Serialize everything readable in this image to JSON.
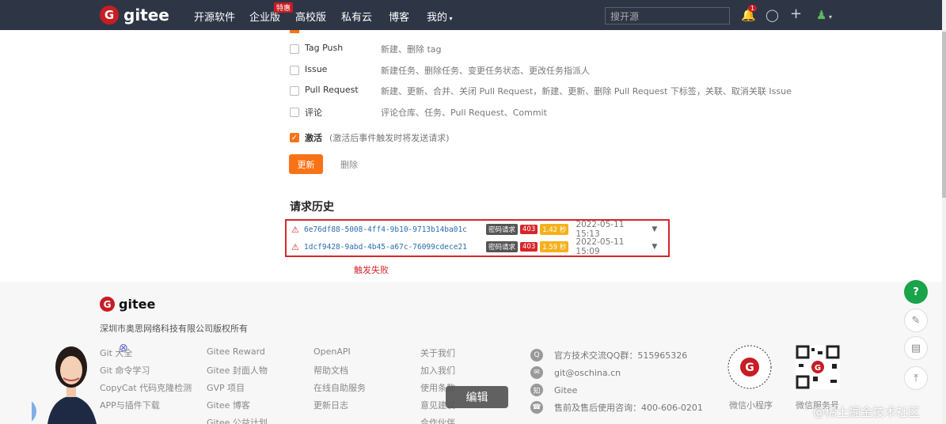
{
  "nav": {
    "logo": "gitee",
    "items": [
      "开源软件",
      "企业版",
      "高校版",
      "私有云",
      "博客",
      "我的"
    ],
    "hot_badge": "特惠",
    "search_placeholder": "搜开源",
    "notif_count": "1"
  },
  "events": [
    {
      "name": "Tag Push",
      "desc": "新建、删除 tag",
      "checked": false
    },
    {
      "name": "Issue",
      "desc": "新建任务、删除任务、变更任务状态、更改任务指派人",
      "checked": false
    },
    {
      "name": "Pull Request",
      "desc": "新建、更新、合并、关闭 Pull Request，新建、更新、删除 Pull Request 下标签，关联、取消关联 Issue",
      "checked": false
    },
    {
      "name": "评论",
      "desc": "评论仓库、任务、Pull Request、Commit",
      "checked": false
    }
  ],
  "activate": {
    "label": "激活",
    "hint": "(激活后事件触发时将发送请求)",
    "checked": true
  },
  "buttons": {
    "update": "更新",
    "delete": "删除"
  },
  "history": {
    "title": "请求历史",
    "rows": [
      {
        "id": "6e76df88-5008-4ff4-9b10-9713b14ba01c",
        "tag": "密码请求",
        "status": "403",
        "duration": "1.42 秒",
        "time": "2022-05-11 15:13"
      },
      {
        "id": "1dcf9428-9abd-4b45-a67c-76099cdece21",
        "tag": "密码请求",
        "status": "403",
        "duration": "1.59 秒",
        "time": "2022-05-11 15:09"
      }
    ],
    "note": "触发失败"
  },
  "footer": {
    "logo": "gitee",
    "company": "深圳市奥思网络科技有限公司版权所有",
    "col1": [
      "Git 大全",
      "Git 命令学习",
      "CopyCat 代码克隆检测",
      "APP与插件下载"
    ],
    "col2": [
      "Gitee Reward",
      "Gitee 封面人物",
      "GVP 项目",
      "Gitee 博客",
      "Gitee 公益计划"
    ],
    "col3": [
      "OpenAPI",
      "帮助文档",
      "在线自助服务",
      "更新日志"
    ],
    "col4": [
      "关于我们",
      "加入我们",
      "使用条款",
      "意见建议",
      "合作伙伴"
    ],
    "contacts": [
      "官方技术交流QQ群：515965326",
      "git@oschina.cn",
      "Gitee",
      "售前及售后使用咨询：400-606-0201"
    ],
    "qr_labels": [
      "微信小程序",
      "微信服务号"
    ]
  },
  "overlay": {
    "edit": "编辑",
    "watermark": "@稀土掘金技术社区"
  }
}
